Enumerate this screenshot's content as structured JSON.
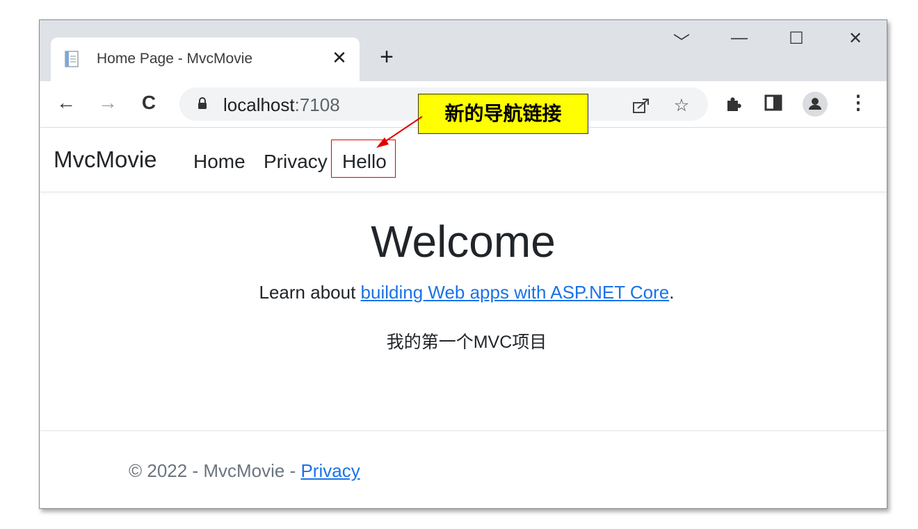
{
  "browser": {
    "tab_title": "Home Page - MvcMovie",
    "tab_close": "✕",
    "new_tab": "+",
    "url_host": "localhost",
    "url_port": ":7108",
    "window_controls": {
      "dropdown": "﹀",
      "minimize": "—",
      "maximize": "☐",
      "close": "✕"
    },
    "nav": {
      "back": "←",
      "forward": "→",
      "reload": "C"
    }
  },
  "navbar": {
    "brand": "MvcMovie",
    "links": [
      "Home",
      "Privacy",
      "Hello"
    ]
  },
  "main": {
    "heading": "Welcome",
    "learn_prefix": "Learn about ",
    "learn_link": "building Web apps with ASP.NET Core",
    "learn_suffix": ".",
    "custom_text": "我的第一个MVC项目"
  },
  "footer": {
    "text": "© 2022 - MvcMovie - ",
    "privacy_link": "Privacy"
  },
  "annotation": {
    "callout_text": "新的导航链接",
    "callout_color": "#ffff00",
    "highlight_color": "#e00000"
  }
}
